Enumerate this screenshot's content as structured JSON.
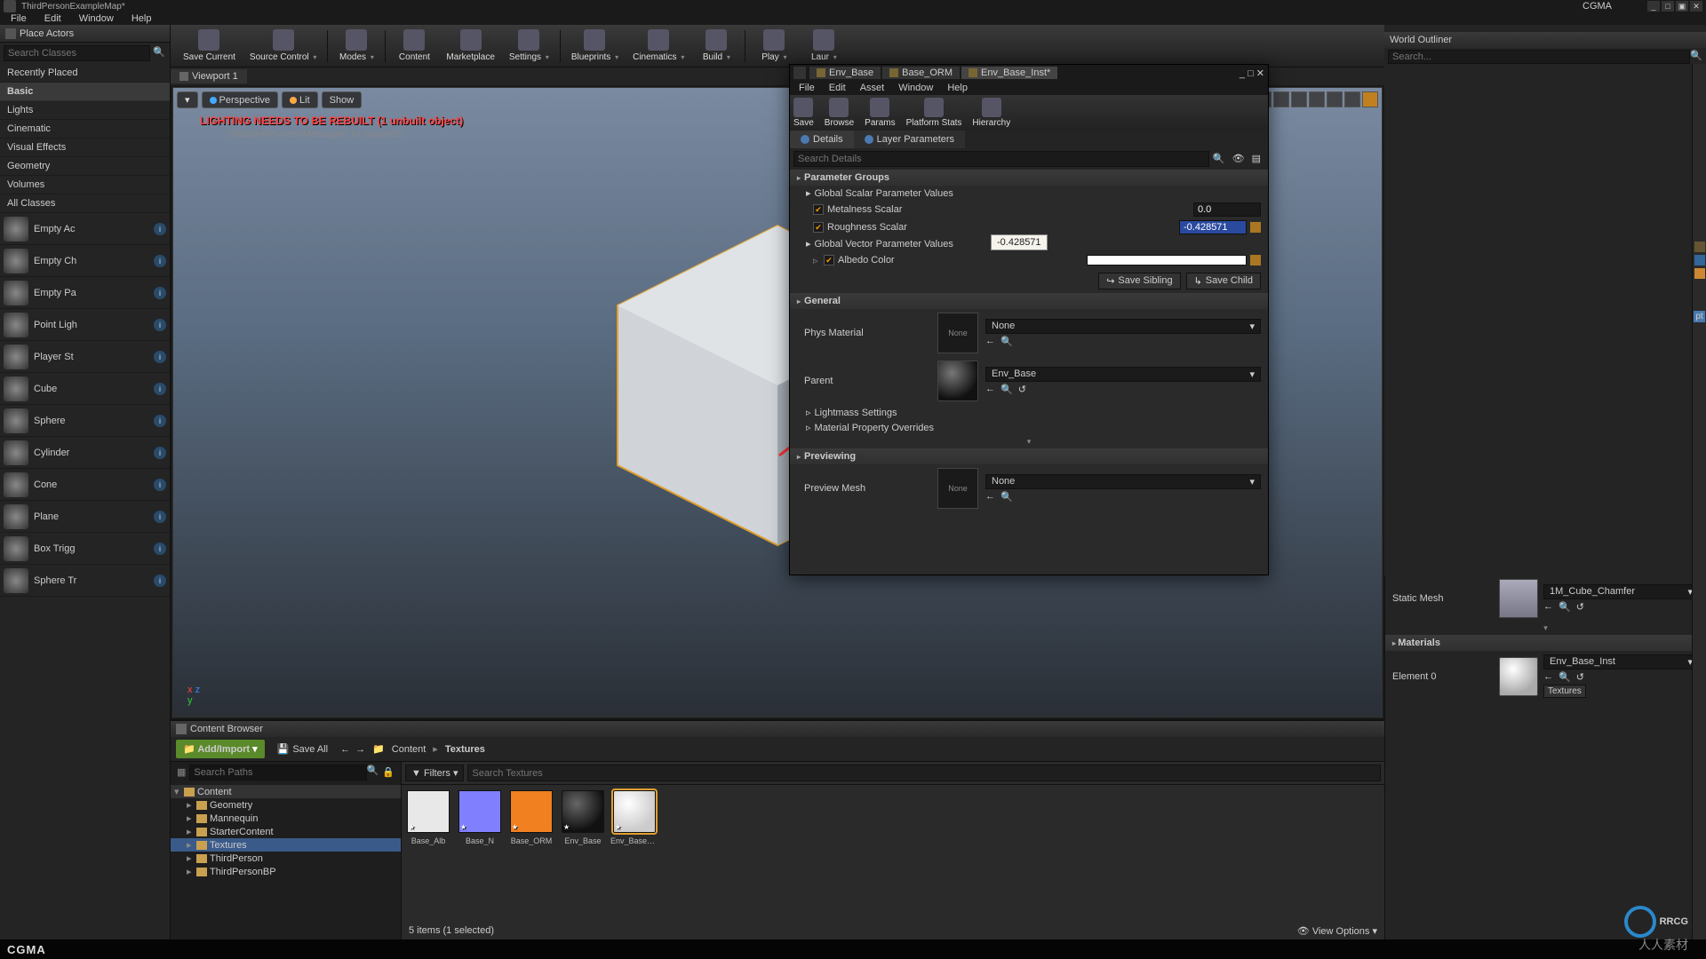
{
  "titlebar": {
    "title": "ThirdPersonExampleMap*",
    "right_label": "CGMA"
  },
  "menubar": [
    "File",
    "Edit",
    "Window",
    "Help"
  ],
  "place_actors": {
    "title": "Place Actors",
    "search_placeholder": "Search Classes",
    "categories": [
      "Recently Placed",
      "Basic",
      "Lights",
      "Cinematic",
      "Visual Effects",
      "Geometry",
      "Volumes",
      "All Classes"
    ],
    "selected_category": "Basic",
    "actors": [
      "Empty Ac",
      "Empty Ch",
      "Empty Pa",
      "Point Ligh",
      "Player St",
      "Cube",
      "Sphere",
      "Cylinder",
      "Cone",
      "Plane",
      "Box Trigg",
      "Sphere Tr"
    ]
  },
  "toolbar": [
    "Save Current",
    "Source Control",
    "Modes",
    "Content",
    "Marketplace",
    "Settings",
    "Blueprints",
    "Cinematics",
    "Build",
    "Play",
    "Laur"
  ],
  "viewport": {
    "tab": "Viewport 1",
    "mode_persp": "Perspective",
    "mode_lit": "Lit",
    "mode_show": "Show",
    "warning": "LIGHTING NEEDS TO BE REBUILT (1 unbuilt object)",
    "warning2": "'DisableAllScreenMessages' to suppress"
  },
  "content_browser": {
    "title": "Content Browser",
    "add_label": "Add/Import",
    "save_all": "Save All",
    "crumb": [
      "Content",
      "Textures"
    ],
    "search_paths_placeholder": "Search Paths",
    "filters_label": "Filters",
    "search_assets_placeholder": "Search Textures",
    "tree": [
      {
        "label": "Content",
        "depth": 0,
        "root": true
      },
      {
        "label": "Geometry",
        "depth": 1
      },
      {
        "label": "Mannequin",
        "depth": 1
      },
      {
        "label": "StarterContent",
        "depth": 1
      },
      {
        "label": "Textures",
        "depth": 1,
        "selected": true
      },
      {
        "label": "ThirdPerson",
        "depth": 1
      },
      {
        "label": "ThirdPersonBP",
        "depth": 1
      }
    ],
    "assets": [
      {
        "name": "Base_Alb",
        "color": "#e8e8e8"
      },
      {
        "name": "Base_N",
        "color": "#8080ff"
      },
      {
        "name": "Base_ORM",
        "color": "#f08020"
      },
      {
        "name": "Env_Base",
        "color": "#222",
        "sphere": true
      },
      {
        "name": "Env_Base_Inst",
        "color": "#eee",
        "sphere": true,
        "selected": true
      }
    ],
    "status": "5 items (1 selected)",
    "view_options": "View Options"
  },
  "outliner": {
    "title": "World Outliner",
    "search_placeholder": "Search...",
    "static_mesh_label": "Static Mesh",
    "static_mesh_value": "1M_Cube_Chamfer",
    "materials_label": "Materials",
    "element0_label": "Element 0",
    "element0_value": "Env_Base_Inst",
    "textures_chip": "Textures"
  },
  "material_editor": {
    "tabs": [
      "Env_Base",
      "Base_ORM",
      "Env_Base_Inst*"
    ],
    "active_tab": 2,
    "menus": [
      "File",
      "Edit",
      "Asset",
      "Window",
      "Help"
    ],
    "toolbtns": [
      "Save",
      "Browse",
      "Params",
      "Platform Stats",
      "Hierarchy"
    ],
    "detail_tabs": [
      "Details",
      "Layer Parameters"
    ],
    "search_placeholder": "Search Details",
    "section_param_groups": "Parameter Groups",
    "sub_scalar": "Global Scalar Parameter Values",
    "metalness": {
      "label": "Metalness Scalar",
      "value": "0.0"
    },
    "roughness": {
      "label": "Roughness Scalar",
      "value": "-0.428571"
    },
    "tooltip_value": "-0.428571",
    "sub_vector": "Global Vector Parameter Values",
    "albedo_label": "Albedo Color",
    "save_sibling": "Save Sibling",
    "save_child": "Save Child",
    "section_general": "General",
    "phys_material_label": "Phys Material",
    "none_label": "None",
    "parent_label": "Parent",
    "parent_value": "Env_Base",
    "lightmass_label": "Lightmass Settings",
    "matprop_label": "Material Property Overrides",
    "section_preview": "Previewing",
    "preview_mesh_label": "Preview Mesh"
  },
  "footer_logo": "CGMA",
  "brand": {
    "name": "RRCG",
    "sub": "人人素材"
  }
}
